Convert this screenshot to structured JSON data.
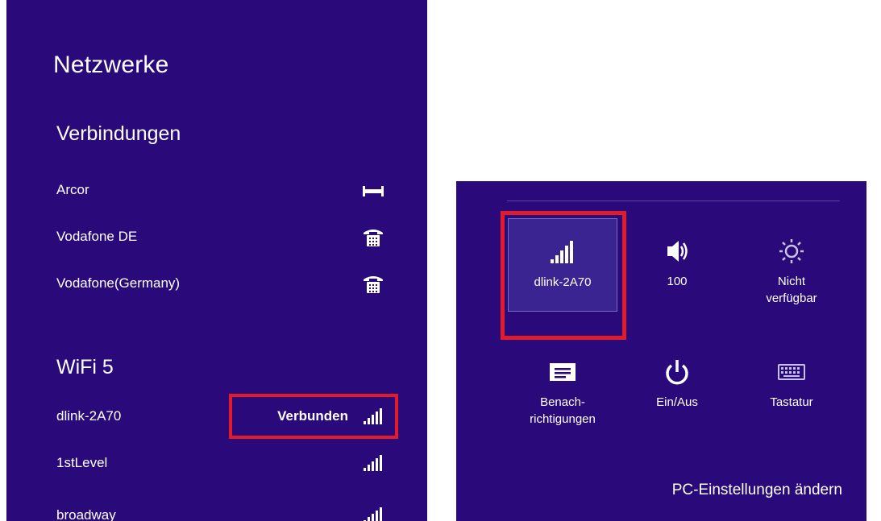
{
  "colors": {
    "panel_bg": "#2a0a7a",
    "text": "#ffffff",
    "highlight": "#e11b2a",
    "active_tile": "#3a2492"
  },
  "networks_panel": {
    "title": "Netzwerke",
    "connections_heading": "Verbindungen",
    "connections": [
      {
        "name": "Arcor",
        "icon": "ethernet-icon"
      },
      {
        "name": "Vodafone DE",
        "icon": "mobile-broadband-icon"
      },
      {
        "name": "Vodafone(Germany)",
        "icon": "mobile-broadband-icon"
      }
    ],
    "wifi_heading": "WiFi 5",
    "wifi_networks": [
      {
        "name": "dlink-2A70",
        "status": "Verbunden",
        "icon": "wifi-signal-icon"
      },
      {
        "name": "1stLevel",
        "status": "",
        "icon": "wifi-signal-icon"
      },
      {
        "name": "broadway",
        "status": "",
        "icon": "wifi-signal-icon"
      }
    ]
  },
  "quick_settings": {
    "tiles": [
      {
        "key": "network",
        "label": "dlink-2A70",
        "icon": "wifi-signal-icon",
        "active": true
      },
      {
        "key": "volume",
        "label": "100",
        "icon": "speaker-icon",
        "active": false
      },
      {
        "key": "brightness",
        "label": "Nicht\nverfügbar",
        "icon": "brightness-icon",
        "active": false
      },
      {
        "key": "notifications",
        "label": "Benach-\nrichtigungen",
        "icon": "notifications-icon",
        "active": false
      },
      {
        "key": "power",
        "label": "Ein/Aus",
        "icon": "power-icon",
        "active": false
      },
      {
        "key": "keyboard",
        "label": "Tastatur",
        "icon": "keyboard-icon",
        "active": false
      }
    ],
    "pc_settings_link": "PC-Einstellungen ändern"
  }
}
